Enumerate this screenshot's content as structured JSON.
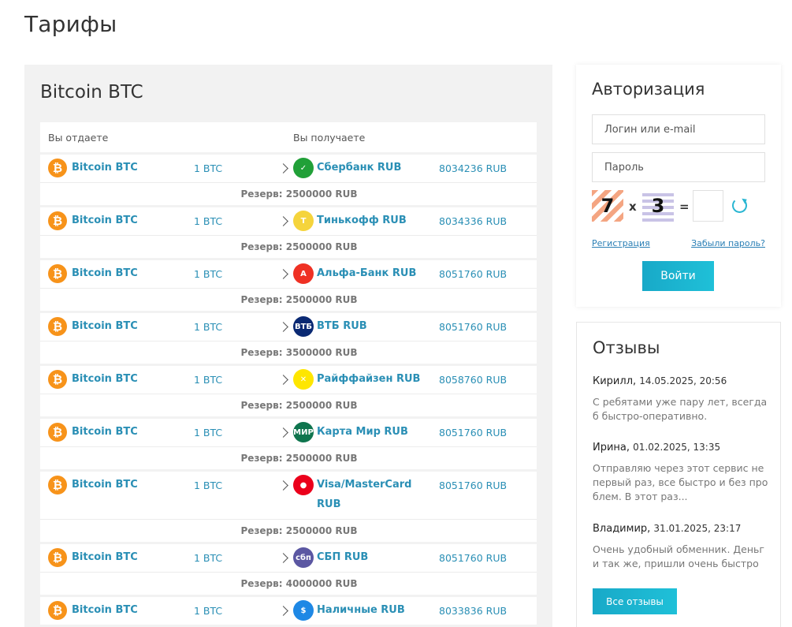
{
  "page": {
    "title": "Тарифы"
  },
  "tariffs": {
    "heading": "Bitcoin BTC",
    "header_give": "Вы отдаете",
    "header_get": "Вы получаете",
    "rows": [
      {
        "from_name": "Bitcoin BTC",
        "from_amount": "1 BTC",
        "to_name": "Сбербанк RUB",
        "to_amount": "8034236 RUB",
        "reserve": "Резерв: 2500000 RUB",
        "icon": "sberbank-icon",
        "icon_color": "#21a038"
      },
      {
        "from_name": "Bitcoin BTC",
        "from_amount": "1 BTC",
        "to_name": "Тинькофф RUB",
        "to_amount": "8034336 RUB",
        "reserve": "Резерв: 2500000 RUB",
        "icon": "tinkoff-icon",
        "icon_color": "#f5d43c"
      },
      {
        "from_name": "Bitcoin BTC",
        "from_amount": "1 BTC",
        "to_name": "Альфа-Банк RUB",
        "to_amount": "8051760 RUB",
        "reserve": "Резерв: 2500000 RUB",
        "icon": "alfabank-icon",
        "icon_color": "#ef3124"
      },
      {
        "from_name": "Bitcoin BTC",
        "from_amount": "1 BTC",
        "to_name": "ВТБ RUB",
        "to_amount": "8051760 RUB",
        "reserve": "Резерв: 3500000 RUB",
        "icon": "vtb-icon",
        "icon_color": "#0a2973"
      },
      {
        "from_name": "Bitcoin BTC",
        "from_amount": "1 BTC",
        "to_name": "Райффайзен RUB",
        "to_amount": "8058760 RUB",
        "reserve": "Резерв: 2500000 RUB",
        "icon": "raiffeisen-icon",
        "icon_color": "#fee600"
      },
      {
        "from_name": "Bitcoin BTC",
        "from_amount": "1 BTC",
        "to_name": "Карта Мир RUB",
        "to_amount": "8051760 RUB",
        "reserve": "Резерв: 2500000 RUB",
        "icon": "mir-icon",
        "icon_color": "#0f754e"
      },
      {
        "from_name": "Bitcoin BTC",
        "from_amount": "1 BTC",
        "to_name": "Visa/MasterCard RUB",
        "to_amount": "8051760 RUB",
        "reserve": "Резерв: 2500000 RUB",
        "icon": "visa-mastercard-icon",
        "icon_color": "#eb001b",
        "two_line": true
      },
      {
        "from_name": "Bitcoin BTC",
        "from_amount": "1 BTC",
        "to_name": "СБП RUB",
        "to_amount": "8051760 RUB",
        "reserve": "Резерв: 4000000 RUB",
        "icon": "sbp-icon",
        "icon_color": "#5b57a2"
      },
      {
        "from_name": "Bitcoin BTC",
        "from_amount": "1 BTC",
        "to_name": "Наличные RUB",
        "to_amount": "8033836 RUB",
        "reserve": "",
        "icon": "cash-icon",
        "icon_color": "#1e88e5"
      }
    ]
  },
  "auth": {
    "title": "Авторизация",
    "login_placeholder": "Логин или e-mail",
    "password_placeholder": "Пароль",
    "captcha_a": "7",
    "captcha_op": "x",
    "captcha_b": "3",
    "captcha_eq": "=",
    "register_link": "Регистрация",
    "forgot_link": "Забыли пароль?",
    "login_button": "Войти"
  },
  "reviews": {
    "title": "Отзывы",
    "items": [
      {
        "author": "Кирилл,",
        "date": "14.05.2025, 20:56",
        "text": "С ребятами уже пару лет, всегда б быстро-оперативно."
      },
      {
        "author": "Ирина,",
        "date": "01.02.2025, 13:35",
        "text": "Отправляю через этот сервис не первый раз, все быстро и без про блем. В этот раз..."
      },
      {
        "author": "Владимир,",
        "date": "31.01.2025, 23:17",
        "text": "Очень удобный обменник. Деньг и так же, пришли очень быстро"
      }
    ],
    "all_button": "Все отзывы"
  }
}
